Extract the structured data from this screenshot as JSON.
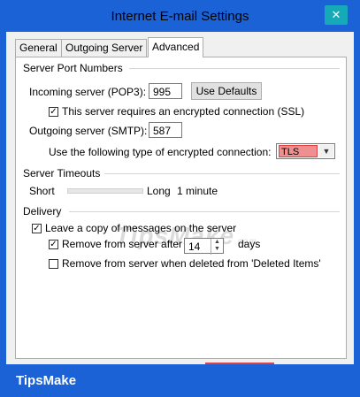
{
  "window": {
    "title": "Internet E-mail Settings",
    "close_glyph": "✕"
  },
  "tabs": [
    {
      "label": "General"
    },
    {
      "label": "Outgoing Server"
    },
    {
      "label": "Advanced",
      "active": true
    }
  ],
  "server_ports": {
    "section_label": "Server Port Numbers",
    "incoming_label": "Incoming server (POP3):",
    "incoming_value": "995",
    "use_defaults_label": "Use Defaults",
    "ssl_checkbox_label": "This server requires an encrypted connection (SSL)",
    "ssl_checked": true,
    "outgoing_label": "Outgoing server (SMTP):",
    "outgoing_value": "587",
    "encryption_label": "Use the following type of encrypted connection:",
    "encryption_value": "TLS"
  },
  "timeouts": {
    "section_label": "Server Timeouts",
    "short_label": "Short",
    "long_label": "Long",
    "value_label": "1 minute"
  },
  "delivery": {
    "section_label": "Delivery",
    "leave_copy_label": "Leave a copy of messages on the server",
    "leave_copy_checked": true,
    "remove_after_label": "Remove from server after",
    "remove_after_checked": true,
    "remove_after_days": "14",
    "days_label": "days",
    "remove_deleted_label": "Remove from server when deleted from 'Deleted Items'",
    "remove_deleted_checked": false
  },
  "watermark": {
    "text": "TipsMake",
    "suffix": ".com"
  },
  "brand": {
    "text": "TipsMake"
  },
  "colors": {
    "titlebar": "#1b62d6",
    "close": "#16a9b8",
    "tls_highlight": "#f08f8f"
  },
  "icons": {
    "close": "close-icon",
    "check": "check-icon",
    "dropdown": "chevron-down-icon"
  }
}
